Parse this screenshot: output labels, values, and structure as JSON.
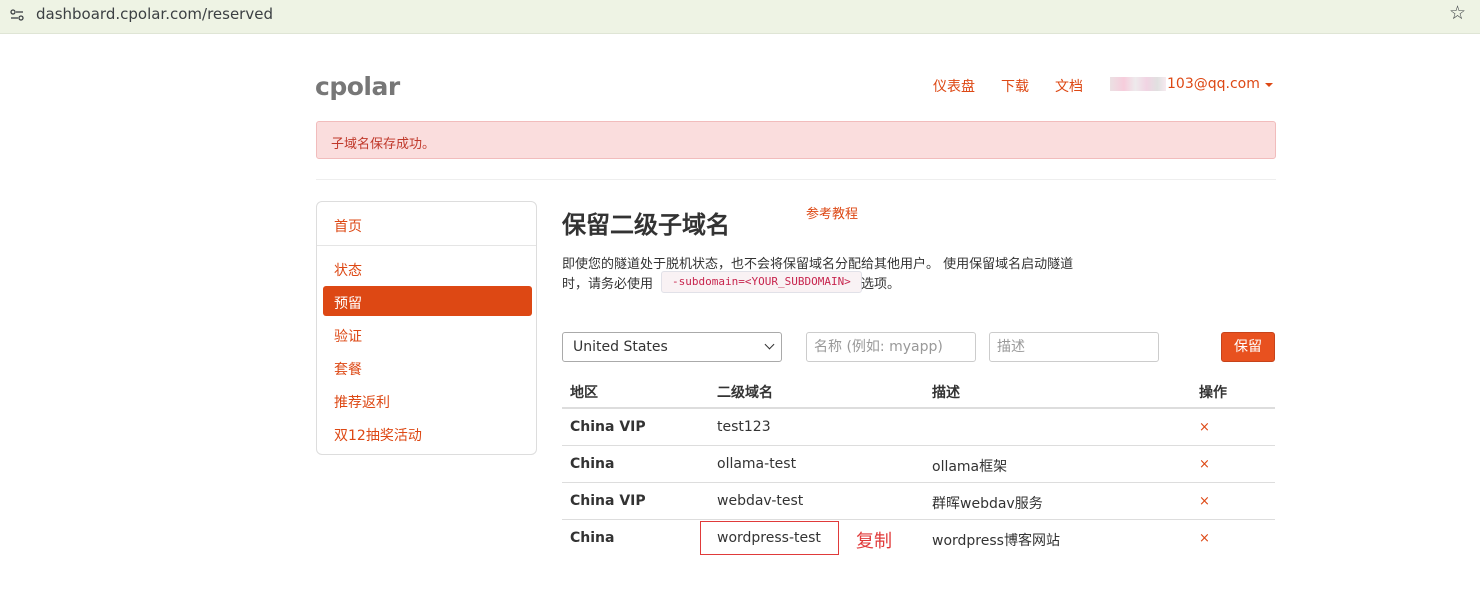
{
  "browser": {
    "url": "dashboard.cpolar.com/reserved"
  },
  "header": {
    "brand": "cpolar",
    "nav": [
      "仪表盘",
      "下载",
      "文档"
    ],
    "user_email_suffix": "103@qq.com"
  },
  "alert": {
    "message": "子域名保存成功。"
  },
  "sidebar": {
    "items": [
      {
        "label": "首页",
        "active": false
      },
      {
        "label": "状态",
        "active": false
      },
      {
        "label": "预留",
        "active": true
      },
      {
        "label": "验证",
        "active": false
      },
      {
        "label": "套餐",
        "active": false
      },
      {
        "label": "推荐返利",
        "active": false
      },
      {
        "label": "双12抽奖活动",
        "active": false
      }
    ]
  },
  "main": {
    "title": "保留二级子域名",
    "tutorial_link": "参考教程",
    "description_line1": "即使您的隧道处于脱机状态，也不会将保留域名分配给其他用户。 使用保留域名启动隧道",
    "description_line2_prefix": "时，请务必使用",
    "code": "-subdomain=<YOUR_SUBDOMAIN>",
    "description_line2_suffix": "选项。"
  },
  "form": {
    "region_selected": "United States",
    "name_placeholder": "名称 (例如: myapp)",
    "desc_placeholder": "描述",
    "save_label": "保留"
  },
  "table": {
    "headers": [
      "地区",
      "二级域名",
      "描述",
      "操作"
    ],
    "rows": [
      {
        "region": "China VIP",
        "subdomain": "test123",
        "description": "",
        "action": "×"
      },
      {
        "region": "China",
        "subdomain": "ollama-test",
        "description": "ollama框架",
        "action": "×"
      },
      {
        "region": "China VIP",
        "subdomain": "webdav-test",
        "description": "群晖webdav服务",
        "action": "×"
      },
      {
        "region": "China",
        "subdomain": "wordpress-test",
        "description": "wordpress博客网站",
        "action": "×"
      }
    ]
  },
  "annotation": {
    "label": "复制",
    "color": "#e03a3a"
  },
  "colors": {
    "accent": "#dd4814",
    "alert_bg": "#fadddd"
  }
}
